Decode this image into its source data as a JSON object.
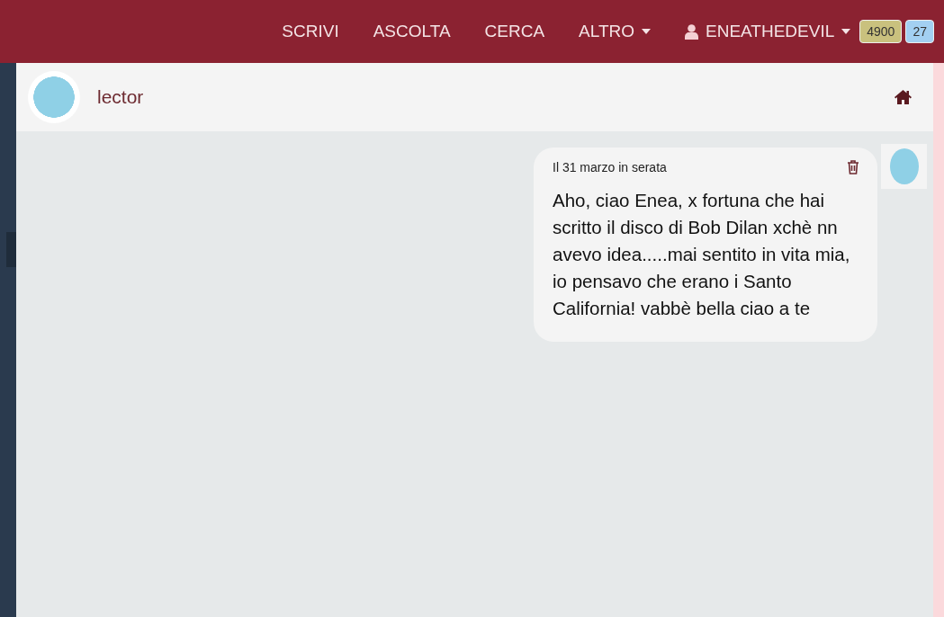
{
  "nav": {
    "items": [
      {
        "label": "SCRIVI",
        "dropdown": false
      },
      {
        "label": "ASCOLTA",
        "dropdown": false
      },
      {
        "label": "CERCA",
        "dropdown": false
      },
      {
        "label": "ALTRO",
        "dropdown": true
      }
    ],
    "user": {
      "name": "ENEATHEDEVIL"
    },
    "badges": [
      {
        "text": "4900",
        "color": "#c9c17e"
      },
      {
        "text": "27",
        "color": "#a3d0f2"
      }
    ]
  },
  "conversation": {
    "title": "lector",
    "messages": [
      {
        "date": "Il 31 marzo in serata",
        "text": "Aho, ciao Enea, x fortuna che hai scritto il disco di Bob Dilan xchè nn avevo idea.....mai sentito in vita mia, io pensavo che erano i Santo California! vabbè bella ciao a te"
      }
    ]
  }
}
